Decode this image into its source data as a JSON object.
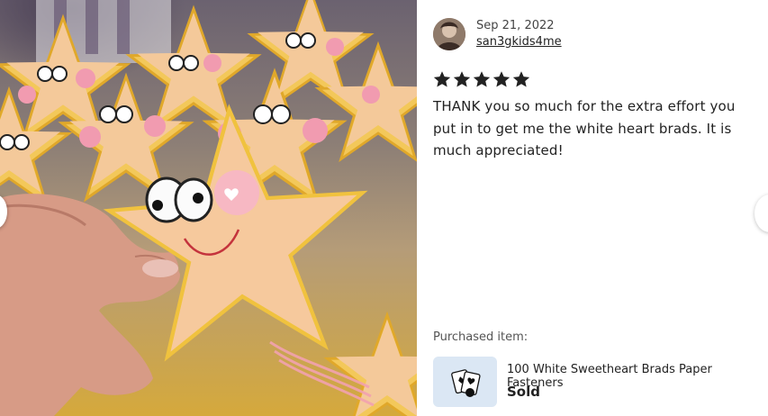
{
  "photo": {
    "alt": "Review photo",
    "prev_icon": "chevron-left-icon",
    "next_icon": "chevron-right-icon"
  },
  "review": {
    "date": "Sep 21, 2022",
    "username": "san3gkids4me",
    "rating": 5,
    "rating_max": 5,
    "text": "THANK you so much for the extra effort you put in to get me the white heart brads. It is much appreciated!",
    "star_color": "#222222"
  },
  "purchased": {
    "label": "Purchased item:",
    "product_name": "100 White Sweetheart Brads Paper Fasteners",
    "status": "Sold",
    "thumb_bg": "#dbe7f4"
  }
}
